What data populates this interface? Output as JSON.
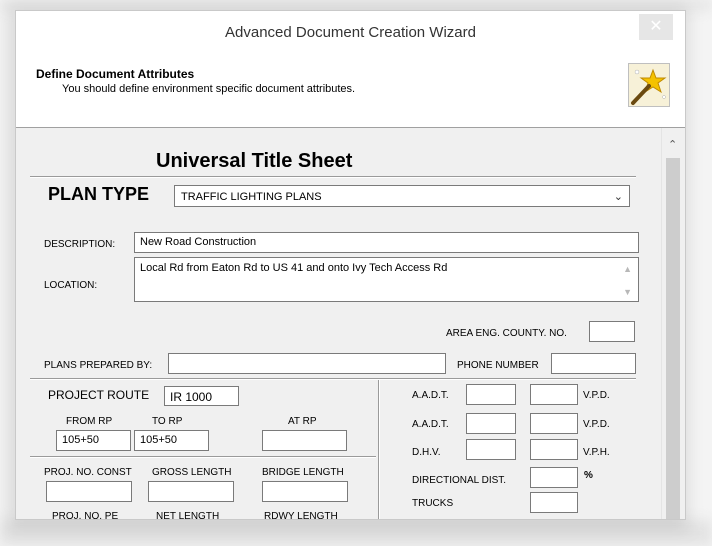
{
  "window": {
    "title": "Advanced Document Creation Wizard",
    "close_glyph": "✕"
  },
  "header": {
    "title": "Define Document Attributes",
    "subtitle": "You should define environment specific document attributes."
  },
  "sheet": {
    "title": "Universal Title Sheet",
    "plan_type_label": "PLAN TYPE",
    "plan_type_value": "TRAFFIC LIGHTING PLANS",
    "description_label": "DESCRIPTION:",
    "description_value": "New Road Construction",
    "location_label": "LOCATION:",
    "location_value": "Local Rd from Eaton Rd to US 41 and onto Ivy Tech Access Rd",
    "area_eng_label": "AREA ENG. COUNTY. NO.",
    "area_eng_value": "",
    "plans_prepared_label": "PLANS PREPARED BY:",
    "plans_prepared_value": "",
    "phone_label": "PHONE NUMBER",
    "phone_value": "",
    "project_route_label": "PROJECT ROUTE",
    "project_route_value": "IR 1000",
    "from_rp_label": "FROM RP",
    "from_rp_value": "105+50",
    "to_rp_label": "TO RP",
    "to_rp_value": "105+50",
    "at_rp_label": "AT RP",
    "at_rp_value": "",
    "proj_no_const_label": "PROJ. NO. CONST",
    "gross_length_label": "GROSS LENGTH",
    "bridge_length_label": "BRIDGE LENGTH",
    "proj_no_pe_label": "PROJ. NO. PE",
    "net_length_label": "NET LENGTH",
    "rdwy_length_label": "RDWY LENGTH",
    "aadt_label_1": "A.A.D.T.",
    "aadt_label_2": "A.A.D.T.",
    "dhv_label": "D.H.V.",
    "vpd_label_1": "V.P.D.",
    "vpd_label_2": "V.P.D.",
    "vph_label": "V.P.H.",
    "directional_label": "DIRECTIONAL DIST.",
    "percent_label": "%",
    "trucks_label": "TRUCKS"
  },
  "icons": {
    "wand": "magic-wand-icon",
    "scroll_up": "▲",
    "dropdown": "⌄"
  },
  "colors": {
    "content_bg": "#f0f0f0",
    "field_border": "#7a7a7a",
    "close_bg": "#e6e6e6"
  }
}
